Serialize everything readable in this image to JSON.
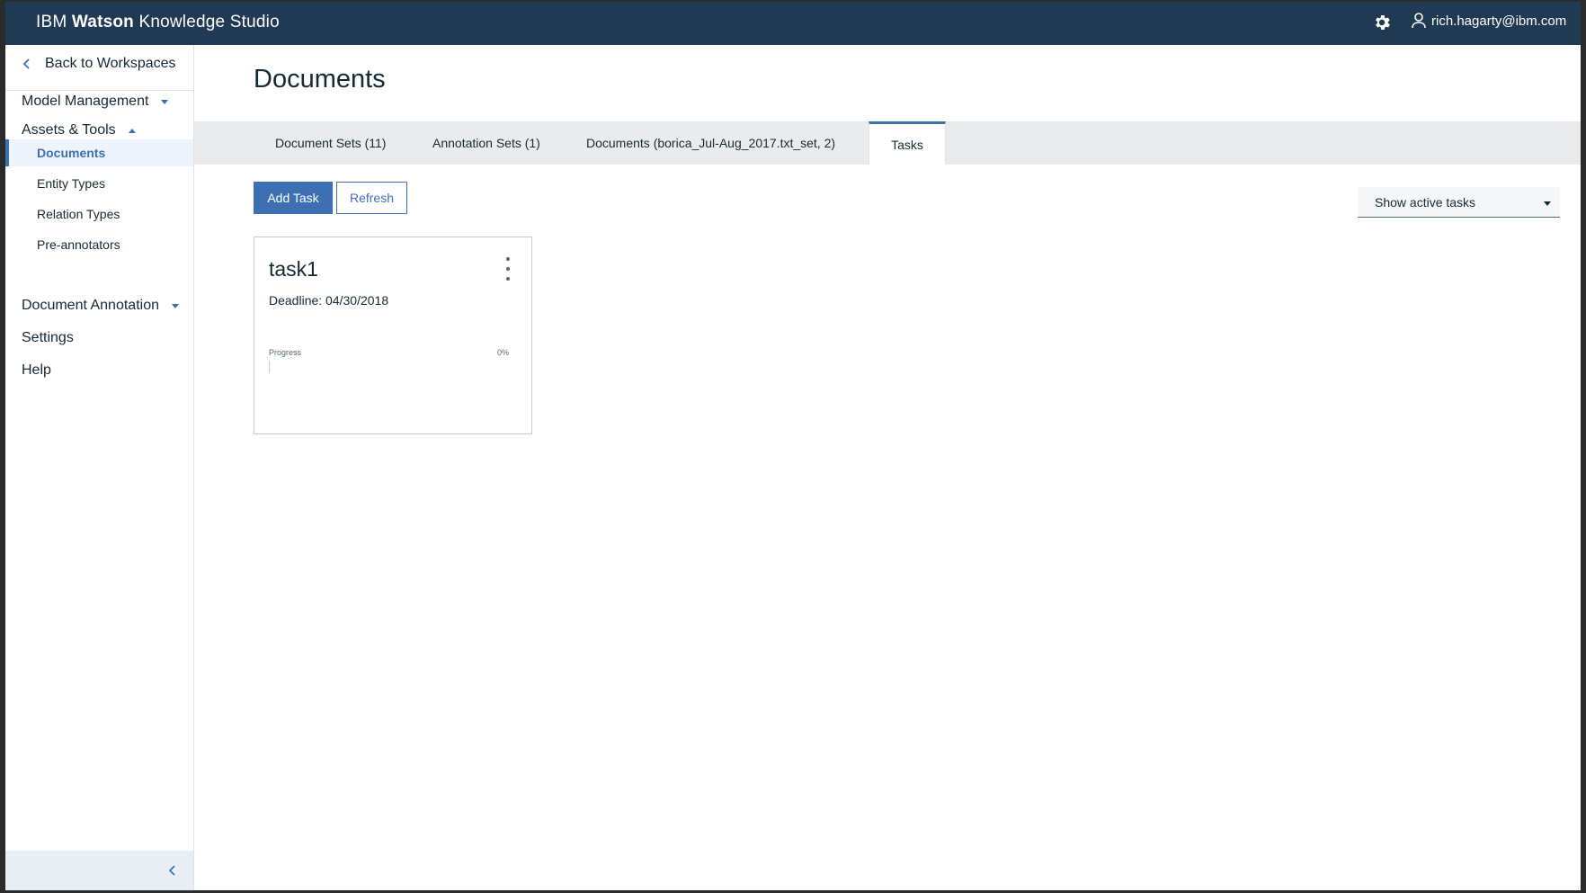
{
  "header": {
    "brand_part1": "IBM",
    "brand_part2": "Watson",
    "brand_part3": "Knowledge Studio",
    "user_email": "rich.hagarty@ibm.com",
    "settings_icon": "gear-icon",
    "user_icon": "user-icon"
  },
  "sidebar": {
    "back_label": "Back to Workspaces",
    "sections": {
      "model_management": "Model Management",
      "assets_tools": "Assets & Tools",
      "document_annotation": "Document Annotation",
      "settings": "Settings",
      "help": "Help"
    },
    "items": [
      "Documents",
      "Entity Types",
      "Relation Types",
      "Pre-annotators"
    ],
    "active_item": "Documents"
  },
  "main": {
    "title": "Documents",
    "tabs": [
      {
        "label": "Document Sets (11)"
      },
      {
        "label": "Annotation Sets (1)"
      },
      {
        "label": "Documents (borica_Jul-Aug_2017.txt_set, 2)"
      },
      {
        "label": "Tasks"
      }
    ],
    "active_tab": "Tasks",
    "add_task_label": "Add Task",
    "refresh_label": "Refresh",
    "filter": {
      "selected": "Show active tasks"
    },
    "task": {
      "name": "task1",
      "deadline": "Deadline: 04/30/2018",
      "progress_label": "Progress",
      "progress_text": "0%",
      "progress_value": 0
    }
  },
  "colors": {
    "topbar": "#1f3a52",
    "accent": "#3d70b2",
    "tabbar": "#e9ebec"
  }
}
